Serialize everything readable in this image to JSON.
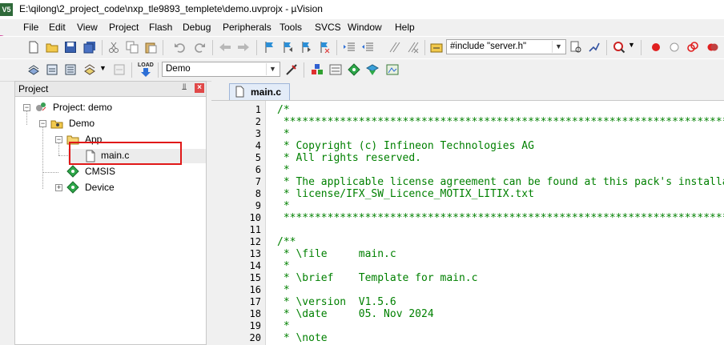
{
  "window": {
    "app_icon_text": "V5",
    "title": "E:\\qilong\\2_project_code\\nxp_tle9893_templete\\demo.uvprojx - µVision"
  },
  "menubar": {
    "items": [
      "File",
      "Edit",
      "View",
      "Project",
      "Flash",
      "Debug",
      "Peripherals",
      "Tools",
      "SVCS",
      "Window",
      "Help"
    ]
  },
  "toolbar1": {
    "include_combo": "#include \"server.h\""
  },
  "toolbar2": {
    "target_combo": "Demo",
    "load_label": "LOAD"
  },
  "project_panel": {
    "title": "Project",
    "pin_glyph": "⫫",
    "close_glyph": "×",
    "tree": {
      "root": "Project: demo",
      "target": "Demo",
      "group_app": "App",
      "file_main": "main.c",
      "group_cmsis": "CMSIS",
      "group_device": "Device"
    }
  },
  "editor": {
    "tab_label": "main.c",
    "line_numbers": [
      "1",
      "2",
      "3",
      "4",
      "5",
      "6",
      "7",
      "8",
      "9",
      "10",
      "11",
      "12",
      "13",
      "14",
      "15",
      "16",
      "17",
      "18",
      "19",
      "20"
    ],
    "lines": [
      "/*",
      " ***********************************************************************************",
      " *",
      " * Copyright (c) Infineon Technologies AG",
      " * All rights reserved.",
      " *",
      " * The applicable license agreement can be found at this pack's installation directory in the file",
      " * license/IFX_SW_Licence_MOTIX_LITIX.txt",
      " *",
      " ***********************************************************************************",
      "",
      "/**",
      " * \\file     main.c",
      " *",
      " * \\brief    Template for main.c",
      " *",
      " * \\version  V1.5.6",
      " * \\date     05. Nov 2024",
      " *",
      " * \\note"
    ]
  },
  "colors": {
    "comment_green": "#008000",
    "highlight_red": "#e01818"
  }
}
